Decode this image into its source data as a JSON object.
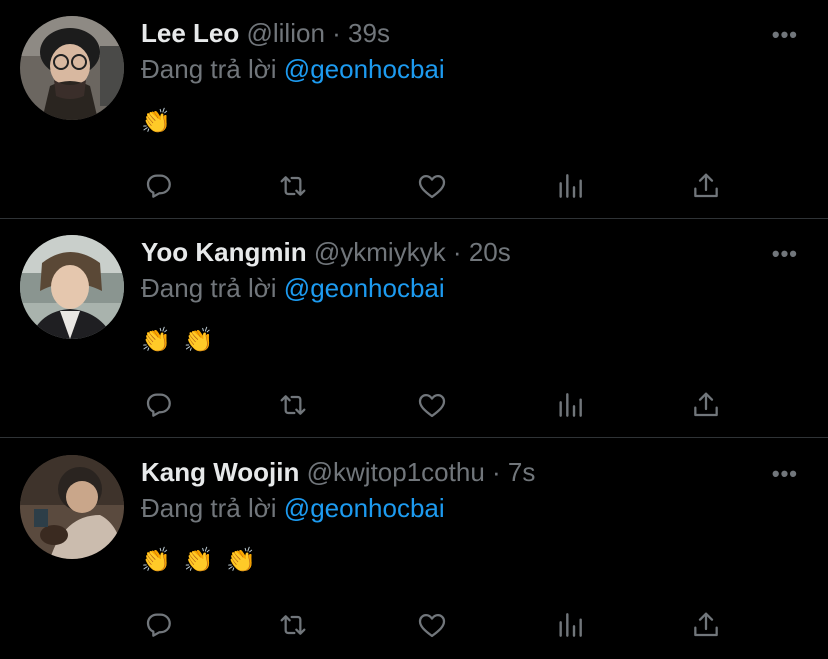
{
  "colors": {
    "background": "#000000",
    "text_primary": "#e7e9ea",
    "text_secondary": "#71767b",
    "mention": "#1d9bf0",
    "divider": "#2f3336"
  },
  "tweets": [
    {
      "display_name": "Lee Leo",
      "handle": "@lilion",
      "separator": "·",
      "time": "39s",
      "replying_prefix": "Đang trả lời",
      "replying_to": "@geonhocbai",
      "emojis": [
        "👏"
      ],
      "avatar": "profile-photo"
    },
    {
      "display_name": "Yoo Kangmin",
      "handle": "@ykmiykyk",
      "separator": "·",
      "time": "20s",
      "replying_prefix": "Đang trả lời",
      "replying_to": "@geonhocbai",
      "emojis": [
        "👏",
        "👏"
      ],
      "avatar": "profile-photo"
    },
    {
      "display_name": "Kang Woojin",
      "handle": "@kwjtop1cothu",
      "separator": "·",
      "time": "7s",
      "replying_prefix": "Đang trả lời",
      "replying_to": "@geonhocbai",
      "emojis": [
        "👏",
        "👏",
        "👏"
      ],
      "avatar": "profile-photo"
    }
  ],
  "icons": {
    "more": "more-horizontal-icon",
    "reply": "reply-icon",
    "retweet": "retweet-icon",
    "like": "heart-icon",
    "views": "views-chart-icon",
    "share": "share-icon"
  }
}
